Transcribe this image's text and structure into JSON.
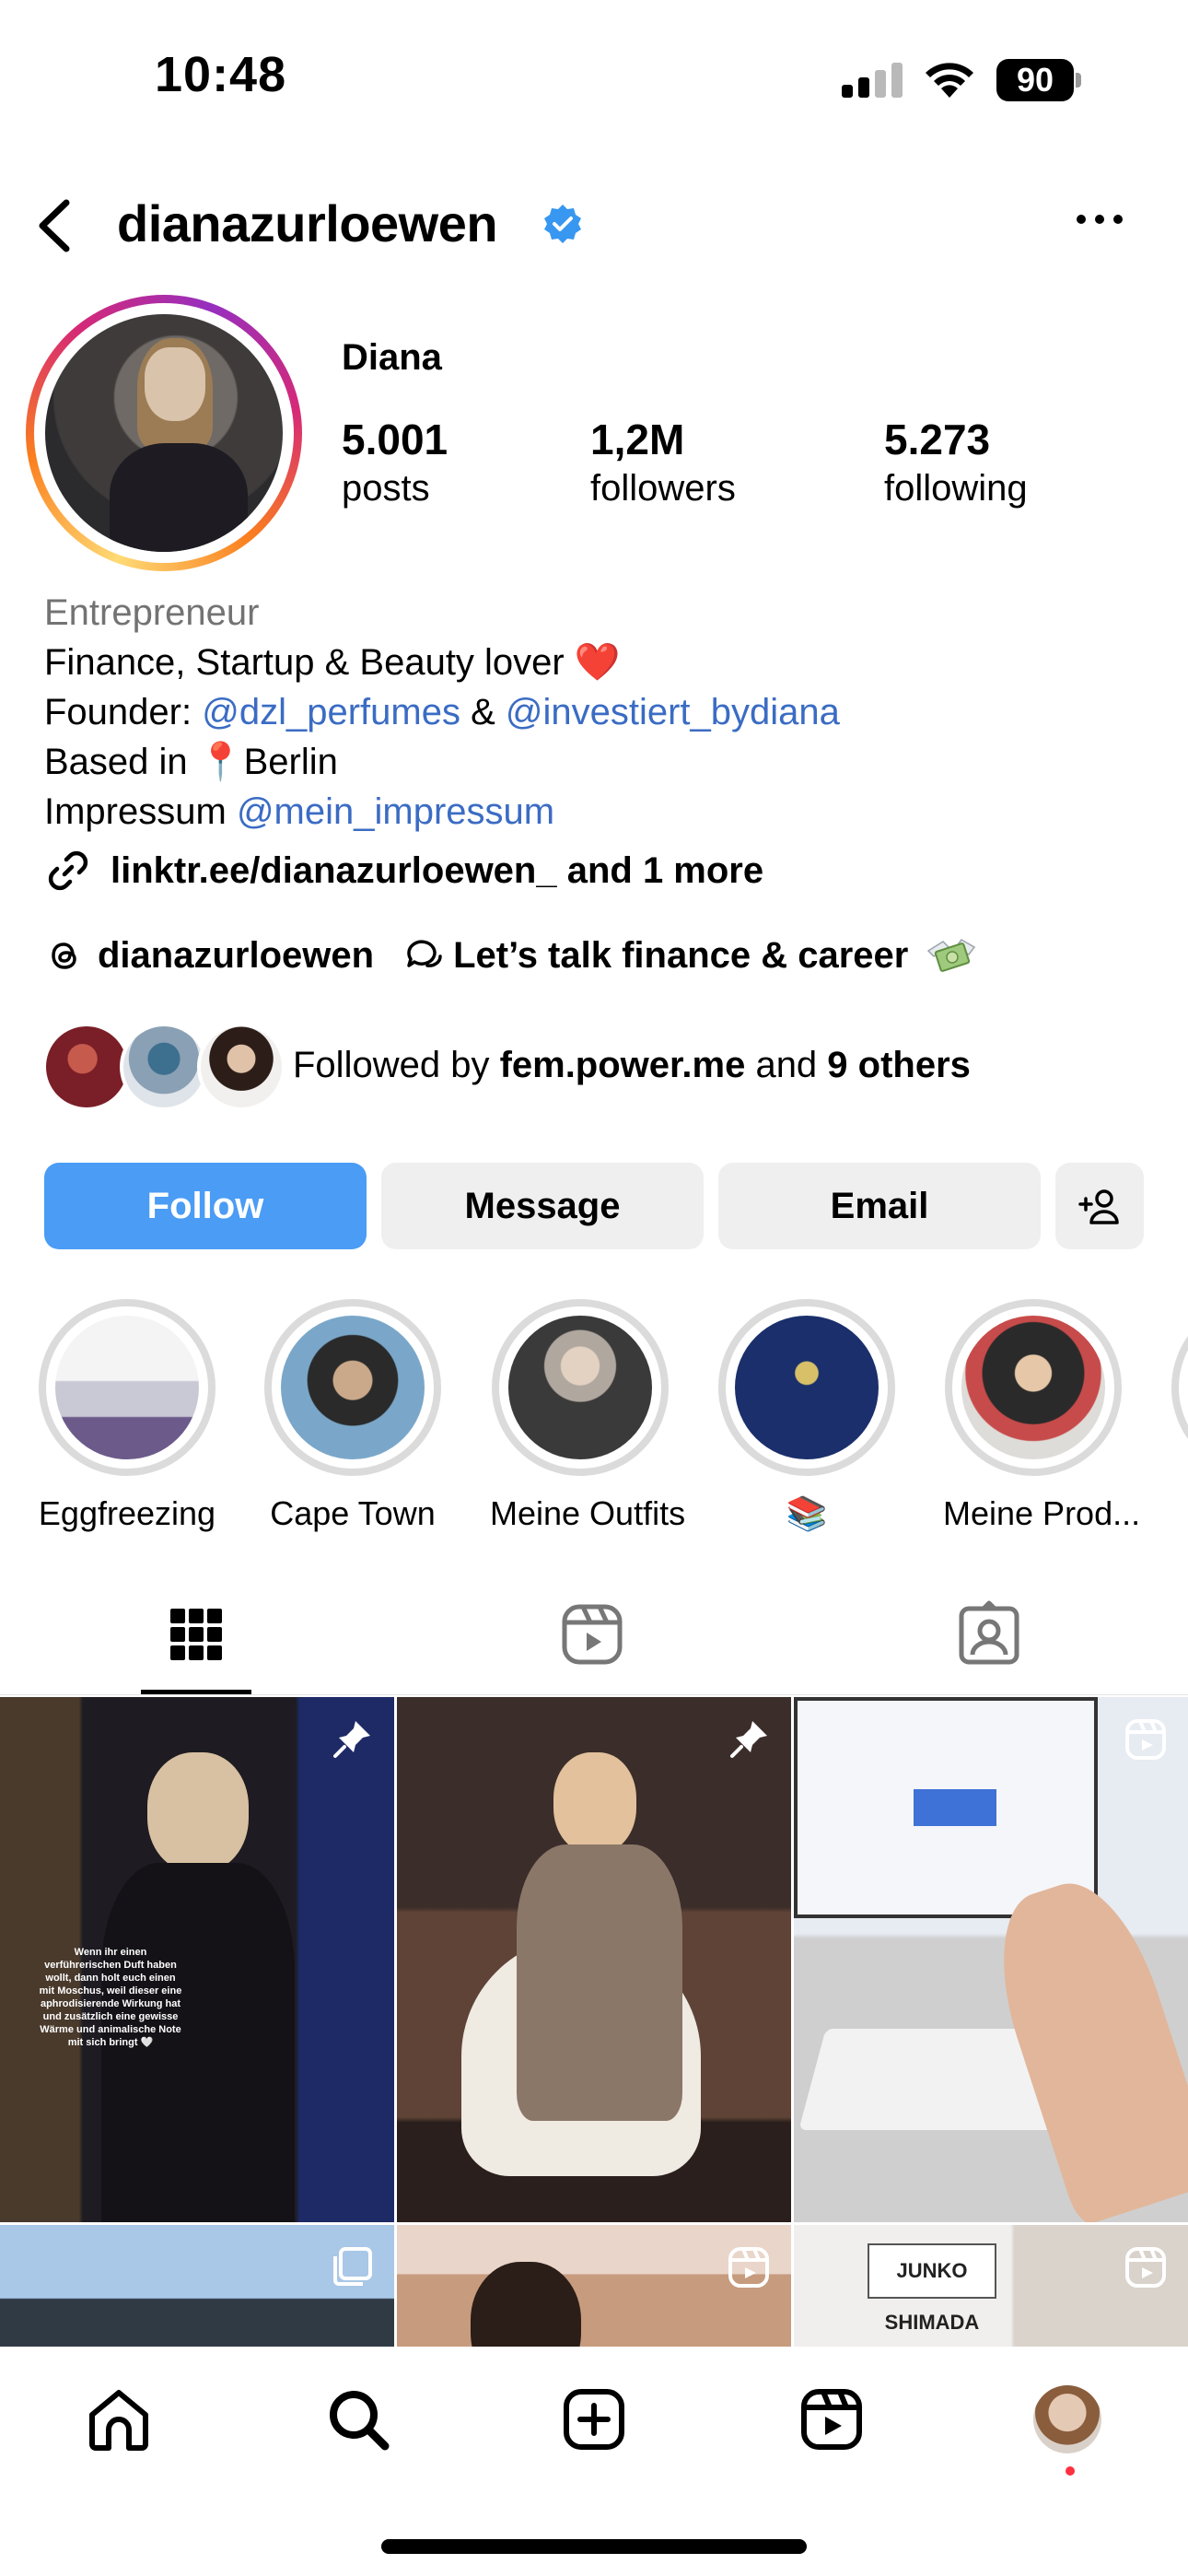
{
  "status_bar": {
    "time": "10:48",
    "battery": "90"
  },
  "header": {
    "username": "dianazurloewen",
    "verified": true
  },
  "profile": {
    "display_name": "Diana",
    "stats": [
      {
        "value": "5.001",
        "label": "posts"
      },
      {
        "value": "1,2M",
        "label": "followers"
      },
      {
        "value": "5.273",
        "label": "following"
      }
    ]
  },
  "bio": {
    "category": "Entrepreneur",
    "line1": "Finance, Startup & Beauty lover",
    "line1_emoji": "❤️",
    "line2_prefix": "Founder: ",
    "line2_mention1": "@dzl_perfumes",
    "line2_and": " & ",
    "line2_mention2": "@investiert_bydiana",
    "line3_prefix": "Based in ",
    "line3_pin": "📍",
    "line3_city": "Berlin",
    "line4_prefix": "Impressum ",
    "line4_mention": "@mein_impressum"
  },
  "links": {
    "link_text": "linktr.ee/dianazurloewen_ and 1 more",
    "threads_handle": "dianazurloewen",
    "channel_text": "Let’s talk finance & career"
  },
  "followed_by": {
    "prefix": "Followed by ",
    "name": "fem.power.me",
    "middle": " and ",
    "others": "9 others"
  },
  "actions": {
    "follow": "Follow",
    "message": "Message",
    "email": "Email"
  },
  "highlights": [
    {
      "label": "Eggfreezing"
    },
    {
      "label": "Cape Town"
    },
    {
      "label": "Meine Outfits"
    },
    {
      "label": "📚"
    },
    {
      "label": "Meine Prod..."
    }
  ],
  "grid": {
    "post1_caption": "Wenn ihr einen verführerischen Duft haben wollt, dann holt euch einen mit Moschus, weil dieser eine aphrodisierende Wirkung hat und zusätzlich eine gewisse Wärme und animalische Note mit sich bringt 🤍",
    "post6_sign": "JUNKO SHIMADA"
  },
  "colors": {
    "accent": "#4a9cf5",
    "mention": "#3b6cc4",
    "secondary_text": "#737373",
    "button_gray": "#efefef",
    "notification_dot": "#ff3040"
  }
}
